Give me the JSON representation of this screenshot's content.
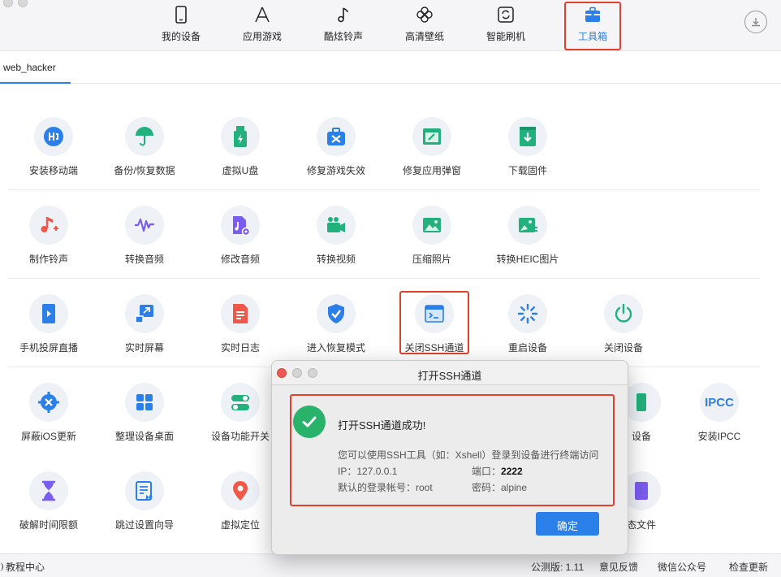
{
  "nav": {
    "tabs": [
      {
        "label": "我的设备",
        "icon": "phone-icon"
      },
      {
        "label": "应用游戏",
        "icon": "app-store-icon"
      },
      {
        "label": "酷炫铃声",
        "icon": "music-note-icon"
      },
      {
        "label": "高清壁纸",
        "icon": "flower-icon"
      },
      {
        "label": "智能刷机",
        "icon": "refresh-icon"
      },
      {
        "label": "工具箱",
        "icon": "toolbox-icon",
        "active": true
      }
    ]
  },
  "device_tab": {
    "label": "web_hacker"
  },
  "tools": {
    "row1": [
      {
        "label": "安装移动端",
        "icon": "install-mobile-icon",
        "color": "#2a7fe8"
      },
      {
        "label": "备份/恢复数据",
        "icon": "umbrella-icon",
        "color": "#22b07d"
      },
      {
        "label": "虚拟U盘",
        "icon": "usb-icon",
        "color": "#22b07d"
      },
      {
        "label": "修复游戏失效",
        "icon": "repair-toolbox-icon",
        "color": "#2a7fe8"
      },
      {
        "label": "修复应用弹窗",
        "icon": "repair-window-icon",
        "color": "#22b07d"
      },
      {
        "label": "下载固件",
        "icon": "download-firmware-icon",
        "color": "#22b07d"
      }
    ],
    "row2": [
      {
        "label": "制作铃声",
        "icon": "ringtone-icon",
        "color": "#f0584a"
      },
      {
        "label": "转换音频",
        "icon": "waveform-icon",
        "color": "#7b5cf0"
      },
      {
        "label": "修改音频",
        "icon": "audio-file-icon",
        "color": "#7b5cf0"
      },
      {
        "label": "转换视频",
        "icon": "video-icon",
        "color": "#22b07d"
      },
      {
        "label": "压缩照片",
        "icon": "photo-icon",
        "color": "#22b07d"
      },
      {
        "label": "转换HEIC图片",
        "icon": "heic-image-icon",
        "color": "#22b07d"
      }
    ],
    "row3": [
      {
        "label": "手机投屏直播",
        "icon": "screen-mirror-icon",
        "color": "#2a7fe8"
      },
      {
        "label": "实时屏幕",
        "icon": "live-screen-icon",
        "color": "#2a7fe8"
      },
      {
        "label": "实时日志",
        "icon": "log-icon",
        "color": "#f0584a"
      },
      {
        "label": "进入恢复模式",
        "icon": "shield-check-icon",
        "color": "#2a7fe8"
      },
      {
        "label": "关闭SSH通道",
        "icon": "terminal-icon",
        "color": "#2a7fe8"
      },
      {
        "label": "重启设备",
        "icon": "spinner-icon",
        "color": "#2a7fe8"
      },
      {
        "label": "关闭设备",
        "icon": "power-icon",
        "color": "#22b07d"
      }
    ],
    "row4": [
      {
        "label": "屏蔽iOS更新",
        "icon": "block-update-icon",
        "color": "#2a7fe8"
      },
      {
        "label": "整理设备桌面",
        "icon": "grid-icon",
        "color": "#2a7fe8"
      },
      {
        "label": "设备功能开关",
        "icon": "toggle-icon",
        "color": "#22b07d"
      },
      {
        "label": "设备",
        "icon": "device-icon",
        "color": "#22b07d"
      },
      {
        "label": "安装IPCC",
        "icon": "ipcc-icon",
        "color": "#2a7fe8",
        "text": "IPCC"
      }
    ],
    "row5": [
      {
        "label": "破解时间限额",
        "icon": "hourglass-icon",
        "color": "#7b5cf0"
      },
      {
        "label": "跳过设置向导",
        "icon": "skip-wizard-icon",
        "color": "#2a7fe8"
      },
      {
        "label": "虚拟定位",
        "icon": "location-pin-icon",
        "color": "#f0584a"
      },
      {
        "label": "态文件",
        "icon": "file-icon",
        "color": "#7b5cf0"
      }
    ]
  },
  "statusbar": {
    "tutorial": "教程中心",
    "version": "公测版: 1.11",
    "feedback": "意见反馈",
    "wechat": "微信公众号",
    "update": "检查更新"
  },
  "dialog": {
    "title": "打开SSH通道",
    "headline": "打开SSH通道成功!",
    "description": "您可以使用SSH工具（如：Xshell）登录到设备进行终端访问",
    "ip_label": "IP：127.0.0.1",
    "port_label": "端口：",
    "port_value": "2222",
    "account_label": "默认的登录帐号：root",
    "password_label": "密码：alpine",
    "ok_button": "确定"
  }
}
